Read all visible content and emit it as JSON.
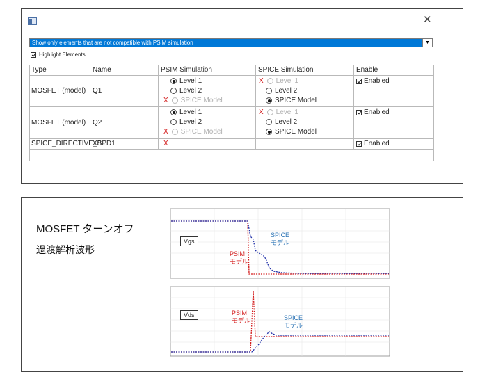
{
  "dialog": {
    "filter_option": "Show only elements that are not compatible with PSIM simulation",
    "highlight_label": "Highlight Elements",
    "columns": [
      "Type",
      "Name",
      "PSIM Simulation",
      "SPICE Simulation",
      "Enable"
    ],
    "rows": [
      {
        "type": "MOSFET (model)",
        "name": "Q1",
        "psim": [
          "Level 1",
          "Level 2",
          "SPICE Model"
        ],
        "spice": [
          "Level 1",
          "Level 2",
          "SPICE Model"
        ],
        "enable": "Enabled"
      },
      {
        "type": "MOSFET (model)",
        "name": "Q2",
        "psim": [
          "Level 1",
          "Level 2",
          "SPICE Model"
        ],
        "spice": [
          "Level 1",
          "Level 2",
          "SPICE Model"
        ],
        "enable": "Enabled"
      },
      {
        "type": "SPICE_DIRECTIVE_B...",
        "name": "XSPD1",
        "enable": "Enabled"
      }
    ],
    "incompatible_mark": "X"
  },
  "figure": {
    "title": "MOSFET ターンオフ",
    "subtitle": "過渡解析波形",
    "top_plot_box": "Vgs",
    "bottom_plot_box": "Vds",
    "psim_label": [
      "PSIM",
      "モデル"
    ],
    "spice_label": [
      "SPICE",
      "モデル"
    ],
    "colors": {
      "psim": "#d31b1b",
      "spice": "#1f2fa8",
      "spice_text": "#2e75b6"
    }
  }
}
